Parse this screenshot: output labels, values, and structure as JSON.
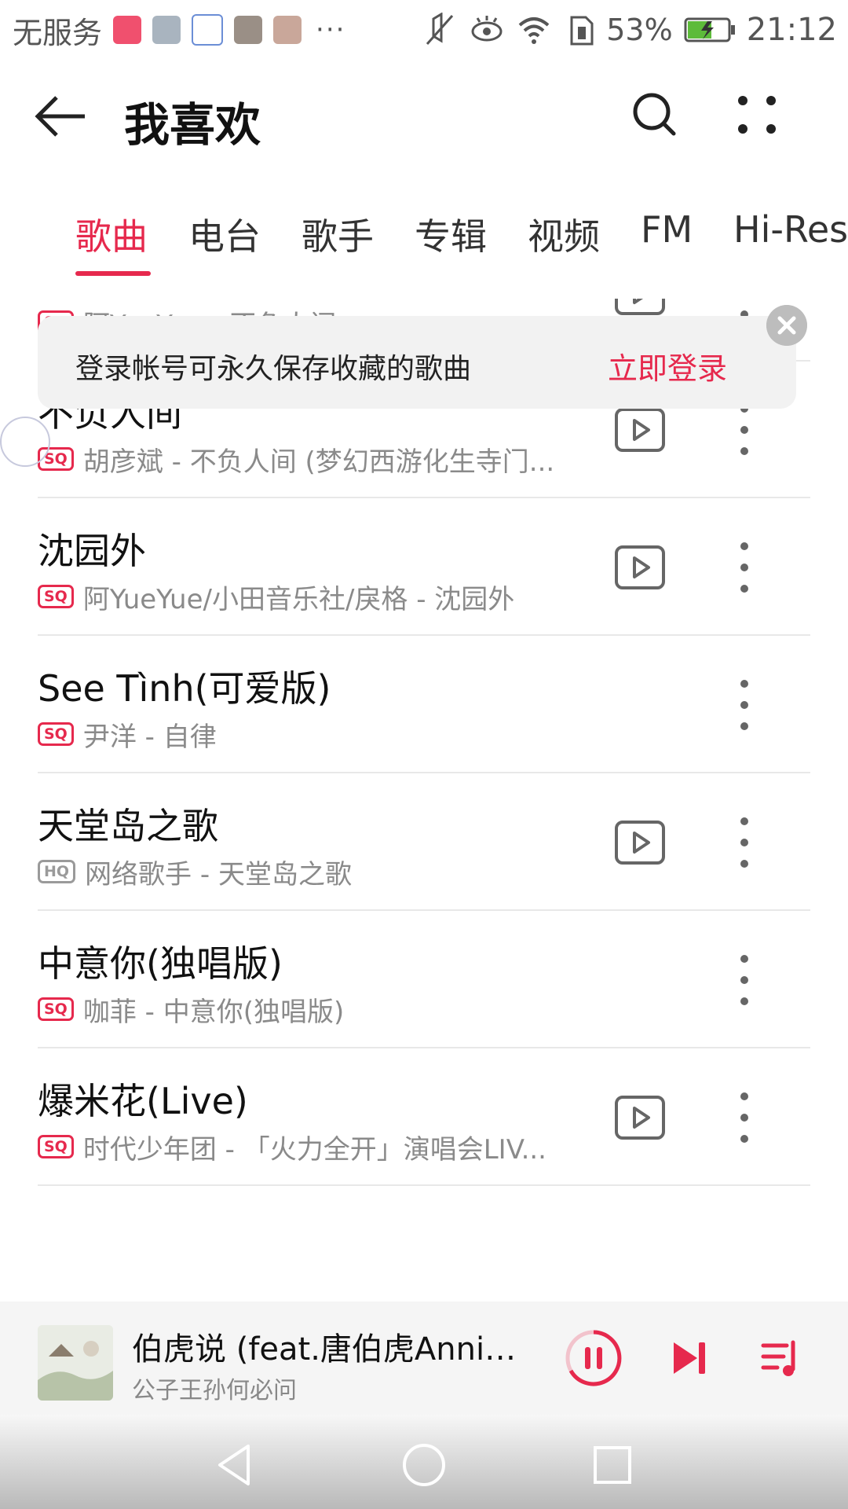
{
  "status_bar": {
    "carrier": "无服务",
    "dots": "···",
    "battery": "53%",
    "time": "21:12"
  },
  "header": {
    "title": "我喜欢"
  },
  "tabs": [
    "歌曲",
    "电台",
    "歌手",
    "专辑",
    "视频",
    "FM",
    "Hi-Res"
  ],
  "banner": {
    "text": "登录帐号可永久保存收藏的歌曲",
    "link": "立即登录"
  },
  "songs": [
    {
      "title": "",
      "quality": "SQ",
      "subtitle": "阿YueYue - 不负人间",
      "has_play": true
    },
    {
      "title": "不负人间",
      "quality": "SQ",
      "subtitle": "胡彦斌 - 不负人间 (梦幻西游化生寺门...",
      "has_play": true
    },
    {
      "title": "沈园外",
      "quality": "SQ",
      "subtitle": "阿YueYue/小田音乐社/戾格 - 沈园外",
      "has_play": true
    },
    {
      "title": "See Tình(可爱版)",
      "quality": "SQ",
      "subtitle": "尹洋 - 自律",
      "has_play": false
    },
    {
      "title": "天堂岛之歌",
      "quality": "HQ",
      "subtitle": "网络歌手 - 天堂岛之歌",
      "has_play": true
    },
    {
      "title": "中意你(独唱版)",
      "quality": "SQ",
      "subtitle": "咖菲 - 中意你(独唱版)",
      "has_play": false
    },
    {
      "title": "爆米花(Live)",
      "quality": "SQ",
      "subtitle": "时代少年团 - 「火力全开」演唱会LIV...",
      "has_play": true
    }
  ],
  "player": {
    "title": "伯虎说 (feat.唐伯虎Annie)(...",
    "artist": "公子王孙何必问"
  },
  "colors": {
    "accent": "#e6294d",
    "text_primary": "#111111",
    "text_secondary": "#8a8a8a"
  },
  "icons": {
    "back": "arrow-left-icon",
    "search": "search-icon",
    "more": "four-dots-icon",
    "play": "play-box-icon",
    "row_more": "vertical-dots-icon",
    "pause": "pause-circle-icon",
    "next": "skip-next-icon",
    "queue": "playlist-icon"
  }
}
